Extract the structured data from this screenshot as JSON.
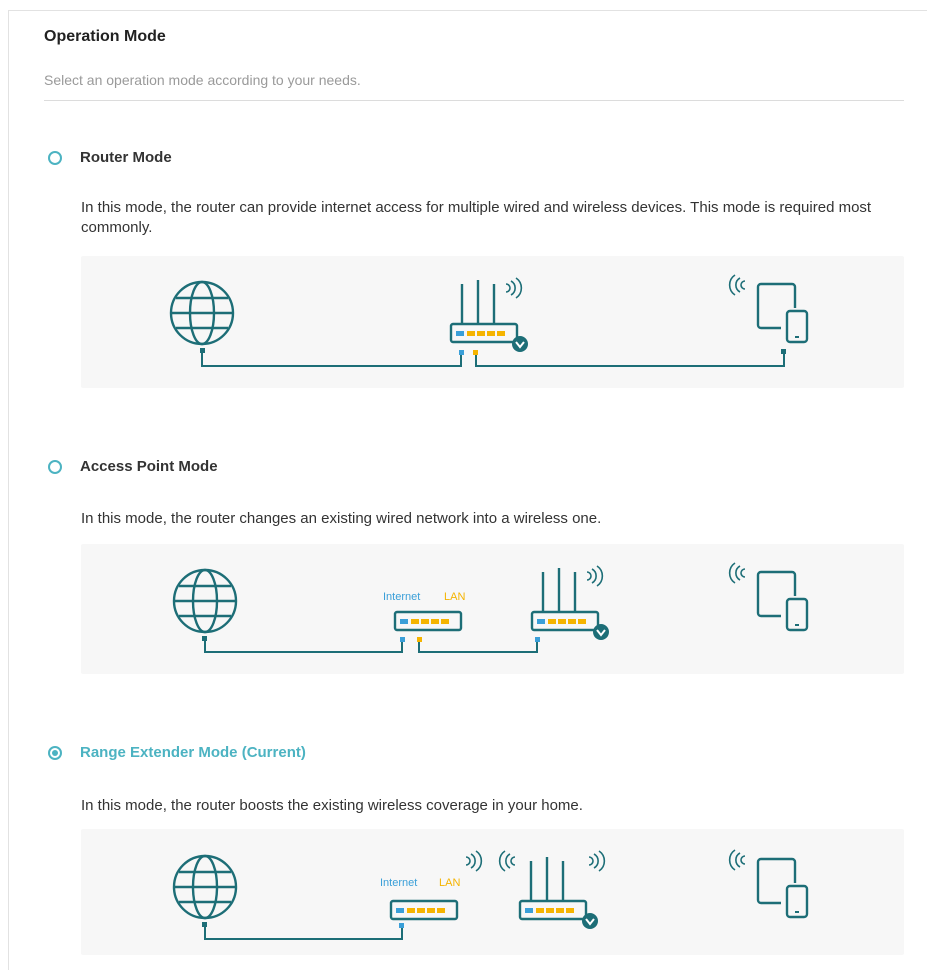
{
  "page": {
    "title": "Operation Mode",
    "subtitle": "Select an operation mode according to your needs."
  },
  "modes": [
    {
      "label": "Router Mode",
      "selected": false,
      "description": "In this mode, the router can provide internet access for multiple wired and wireless devices. This mode is required most commonly.",
      "diagram_icons": [
        "globe-icon",
        "router-icon",
        "devices-icon"
      ]
    },
    {
      "label": "Access Point Mode",
      "selected": false,
      "description": "In this mode, the router changes an existing wired network into a wireless one.",
      "diagram_icons": [
        "globe-icon",
        "modem-icon",
        "router-icon",
        "devices-icon"
      ],
      "port_labels": {
        "internet": "Internet",
        "lan": "LAN"
      }
    },
    {
      "label": "Range Extender Mode (Current)",
      "selected": true,
      "description": "In this mode, the router boosts the existing wireless coverage in your home.",
      "diagram_icons": [
        "globe-icon",
        "host-router-icon",
        "router-icon",
        "devices-icon"
      ],
      "port_labels": {
        "internet": "Internet",
        "lan": "LAN"
      }
    }
  ],
  "colors": {
    "accent": "#4cb3c2",
    "icon": "#1d6e77",
    "lan_port": "#f5b400",
    "wan_port": "#3a9fd8",
    "panel_bg": "#f7f7f7"
  }
}
